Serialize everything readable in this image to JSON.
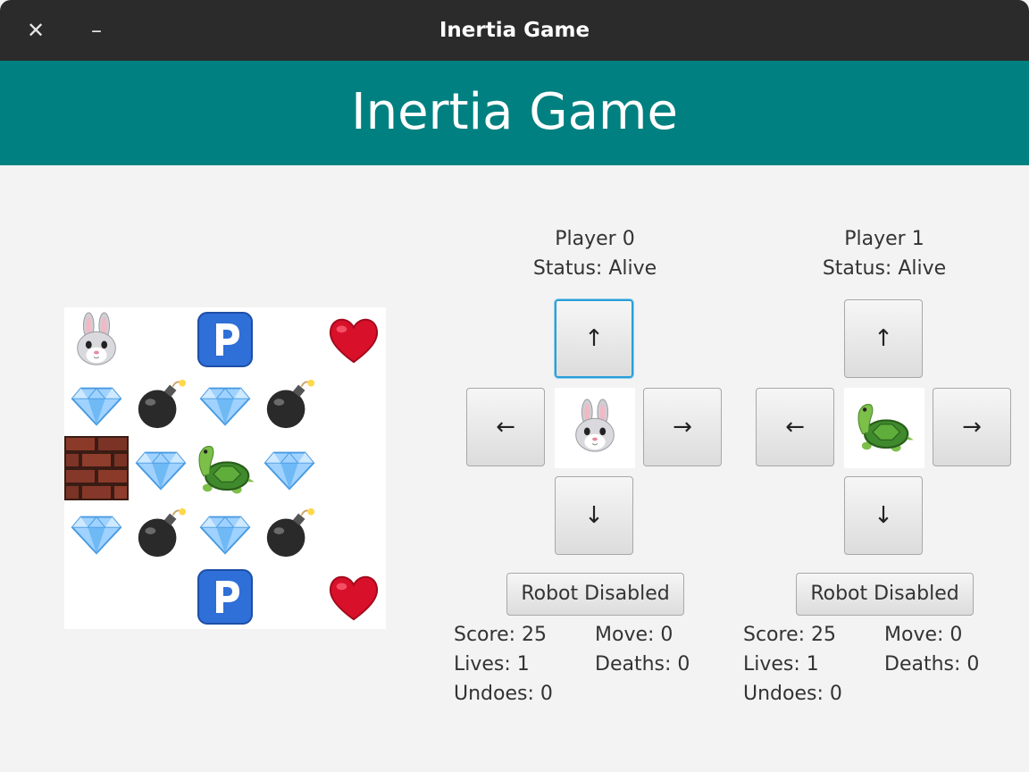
{
  "window": {
    "title": "Inertia Game"
  },
  "header": {
    "title": "Inertia Game"
  },
  "board": {
    "rows": 5,
    "cols": 5,
    "cells": [
      [
        "rabbit",
        "empty",
        "parking",
        "empty",
        "heart"
      ],
      [
        "diamond",
        "bomb",
        "diamond",
        "bomb",
        "empty"
      ],
      [
        "brick",
        "diamond",
        "turtle",
        "diamond",
        "empty"
      ],
      [
        "diamond",
        "bomb",
        "diamond",
        "bomb",
        "empty"
      ],
      [
        "empty",
        "empty",
        "parking",
        "empty",
        "heart"
      ]
    ]
  },
  "players": [
    {
      "name": "Player 0",
      "status": "Status: Alive",
      "avatar": "rabbit-icon",
      "up": "↑",
      "down": "↓",
      "left": "←",
      "right": "→",
      "robot": "Robot Disabled",
      "score": "Score: 25",
      "move": "Move: 0",
      "lives": "Lives: 1",
      "deaths": "Deaths: 0",
      "undoes": "Undoes: 0"
    },
    {
      "name": "Player 1",
      "status": "Status: Alive",
      "avatar": "turtle-icon",
      "up": "↑",
      "down": "↓",
      "left": "←",
      "right": "→",
      "robot": "Robot Disabled",
      "score": "Score: 25",
      "move": "Move: 0",
      "lives": "Lives: 1",
      "deaths": "Deaths: 0",
      "undoes": "Undoes: 0"
    }
  ],
  "colors": {
    "header": "#008080",
    "titlebar": "#2b2b2b",
    "focus": "#2a9fd6"
  }
}
